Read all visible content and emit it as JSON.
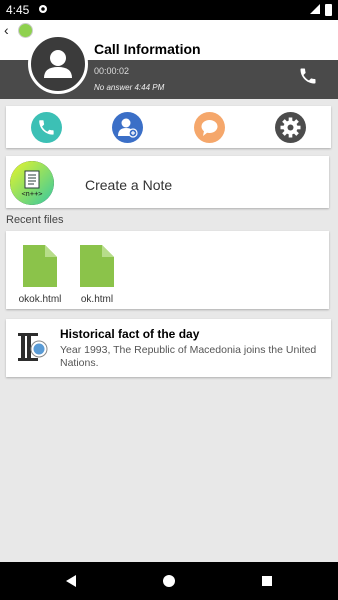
{
  "status_bar": {
    "time": "4:45"
  },
  "header": {
    "title": "Call Information",
    "duration": "00:00:02",
    "call_status": "No answer 4:44 PM"
  },
  "actions": [
    {
      "name": "call",
      "color": "#3cc0b5"
    },
    {
      "name": "add-contact",
      "color": "#3b6fc7"
    },
    {
      "name": "message",
      "color": "#f5a76b"
    },
    {
      "name": "settings",
      "color": "#4c4c4c"
    }
  ],
  "note": {
    "label": "Create a Note",
    "logo_text": "<n++>"
  },
  "recent_files": {
    "label": "Recent files",
    "items": [
      {
        "name": "okok.html"
      },
      {
        "name": "ok.html"
      }
    ]
  },
  "fact": {
    "title": "Historical fact of the day",
    "body": "Year 1993, The Republic of Macedonia joins the United Nations."
  },
  "colors": {
    "file_green": "#8bc34a",
    "dark_header": "#4a4a4a"
  }
}
